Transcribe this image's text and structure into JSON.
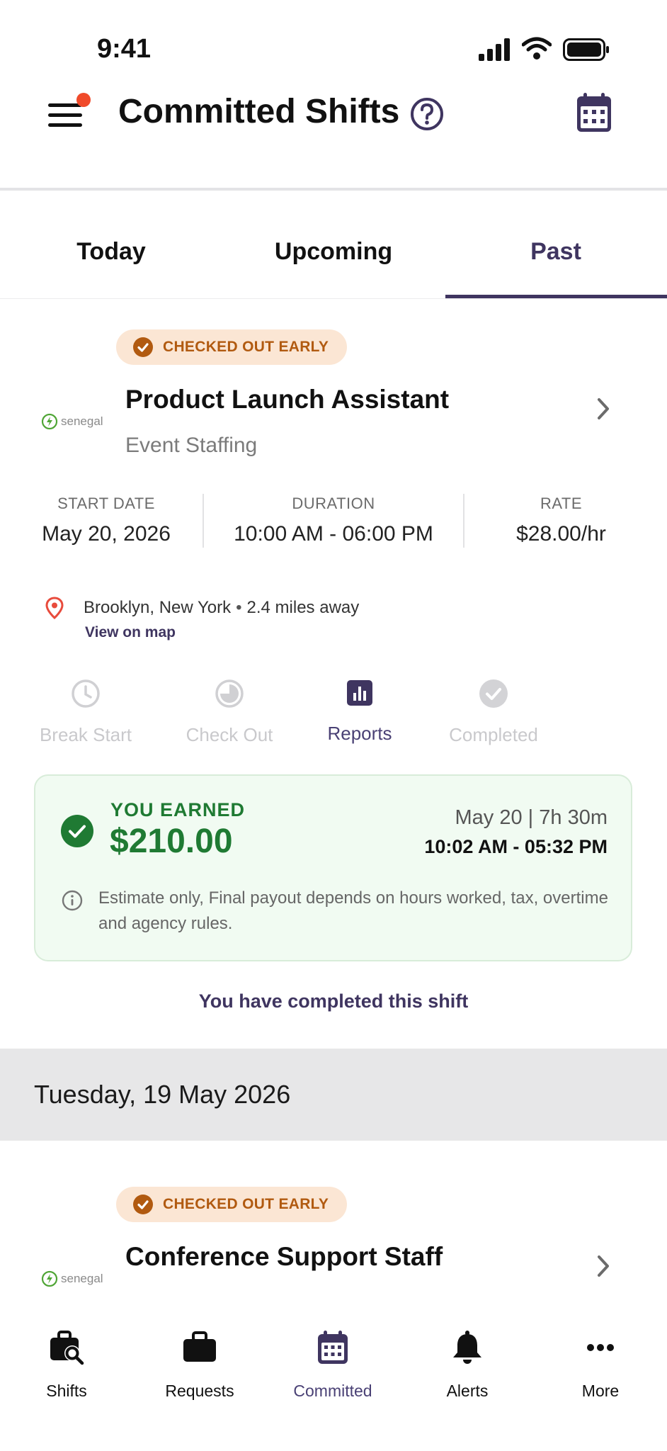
{
  "status_bar": {
    "time": "9:41"
  },
  "header": {
    "title": "Committed Shifts"
  },
  "tabs": [
    {
      "label": "Today",
      "active": false
    },
    {
      "label": "Upcoming",
      "active": false
    },
    {
      "label": "Past",
      "active": true
    }
  ],
  "shift1": {
    "badge": "CHECKED OUT EARLY",
    "company_logo": "senegal",
    "title": "Product Launch Assistant",
    "category": "Event Staffing",
    "start_date_label": "START DATE",
    "start_date": "May 20, 2026",
    "duration_label": "DURATION",
    "duration": "10:00 AM - 06:00 PM",
    "rate_label": "RATE",
    "rate": "$28.00/hr",
    "location": "Brooklyn, New York",
    "distance": "2.4 miles away",
    "map_link": "View on map",
    "actions": [
      {
        "label": "Break Start",
        "icon": "clock-icon"
      },
      {
        "label": "Check Out",
        "icon": "half-moon-icon"
      },
      {
        "label": "Reports",
        "icon": "bar-chart-icon"
      },
      {
        "label": "Completed",
        "icon": "check-circle-icon"
      }
    ],
    "earnings": {
      "label": "YOU EARNED",
      "amount": "$210.00",
      "date_hours": "May 20 | 7h 30m",
      "time_range": "10:02 AM - 05:32 PM",
      "note": "Estimate only, Final payout depends on hours worked, tax, overtime and agency rules."
    },
    "completed_message": "You have completed this shift"
  },
  "date_section": "Tuesday, 19 May 2026",
  "shift2": {
    "badge": "CHECKED OUT EARLY",
    "company_logo": "senegal",
    "title": "Conference Support Staff"
  },
  "bottom_nav": [
    {
      "label": "Shifts",
      "icon": "briefcase-search-icon"
    },
    {
      "label": "Requests",
      "icon": "briefcase-icon"
    },
    {
      "label": "Committed",
      "icon": "calendar-icon"
    },
    {
      "label": "Alerts",
      "icon": "bell-icon"
    },
    {
      "label": "More",
      "icon": "more-dots-icon"
    }
  ],
  "colors": {
    "primary": "#3f3560",
    "badge_bg": "#fbe6d4",
    "badge_text": "#b15a10",
    "earned_green": "#1f7a33",
    "notification_dot": "#f04a2a",
    "location_pin": "#e84b3c"
  }
}
